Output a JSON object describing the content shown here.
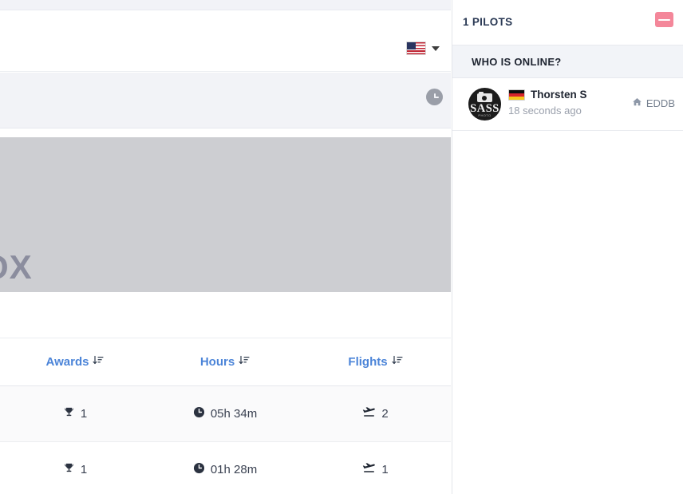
{
  "left": {
    "language_selector": {
      "flag": "us-flag-icon",
      "caret": "chevron-down-icon",
      "selected_language": "English"
    },
    "clock_badge_icon": "clock-icon",
    "hero": {
      "partial_text": "OX"
    },
    "table": {
      "columns": [
        {
          "label": "Awards",
          "sort_icon": "sort-amount-down-icon",
          "key": "awards"
        },
        {
          "label": "Hours",
          "sort_icon": "sort-amount-down-icon",
          "key": "hours"
        },
        {
          "label": "Flights",
          "sort_icon": "sort-amount-down-icon",
          "key": "flights"
        }
      ],
      "rows": [
        {
          "awards": "1",
          "awards_icon": "trophy-icon",
          "hours": "05h 34m",
          "hours_icon": "clock-icon",
          "flights": "2",
          "flights_icon": "plane-departure-icon"
        },
        {
          "awards": "1",
          "awards_icon": "trophy-icon",
          "hours": "01h 28m",
          "hours_icon": "clock-icon",
          "flights": "1",
          "flights_icon": "plane-departure-icon"
        }
      ]
    }
  },
  "right": {
    "header": {
      "title": "1 PILOTS",
      "collapse_icon": "minus-icon",
      "collapse_color": "#f4879a"
    },
    "section": {
      "title": "WHO IS ONLINE?"
    },
    "pilots": [
      {
        "avatar_text": "SASS",
        "avatar_sub": "PHOTO",
        "avatar_icon": "camera-icon",
        "flag": "de-flag-icon",
        "name": "Thorsten S",
        "last_seen": "18 seconds ago",
        "location_icon": "home-icon",
        "location": "EDDB"
      }
    ]
  },
  "colors": {
    "link_blue": "#4b84d8",
    "panel_bg": "#f2f4f8",
    "banner_gray": "#cdced2",
    "accent_pink": "#f4879a"
  }
}
